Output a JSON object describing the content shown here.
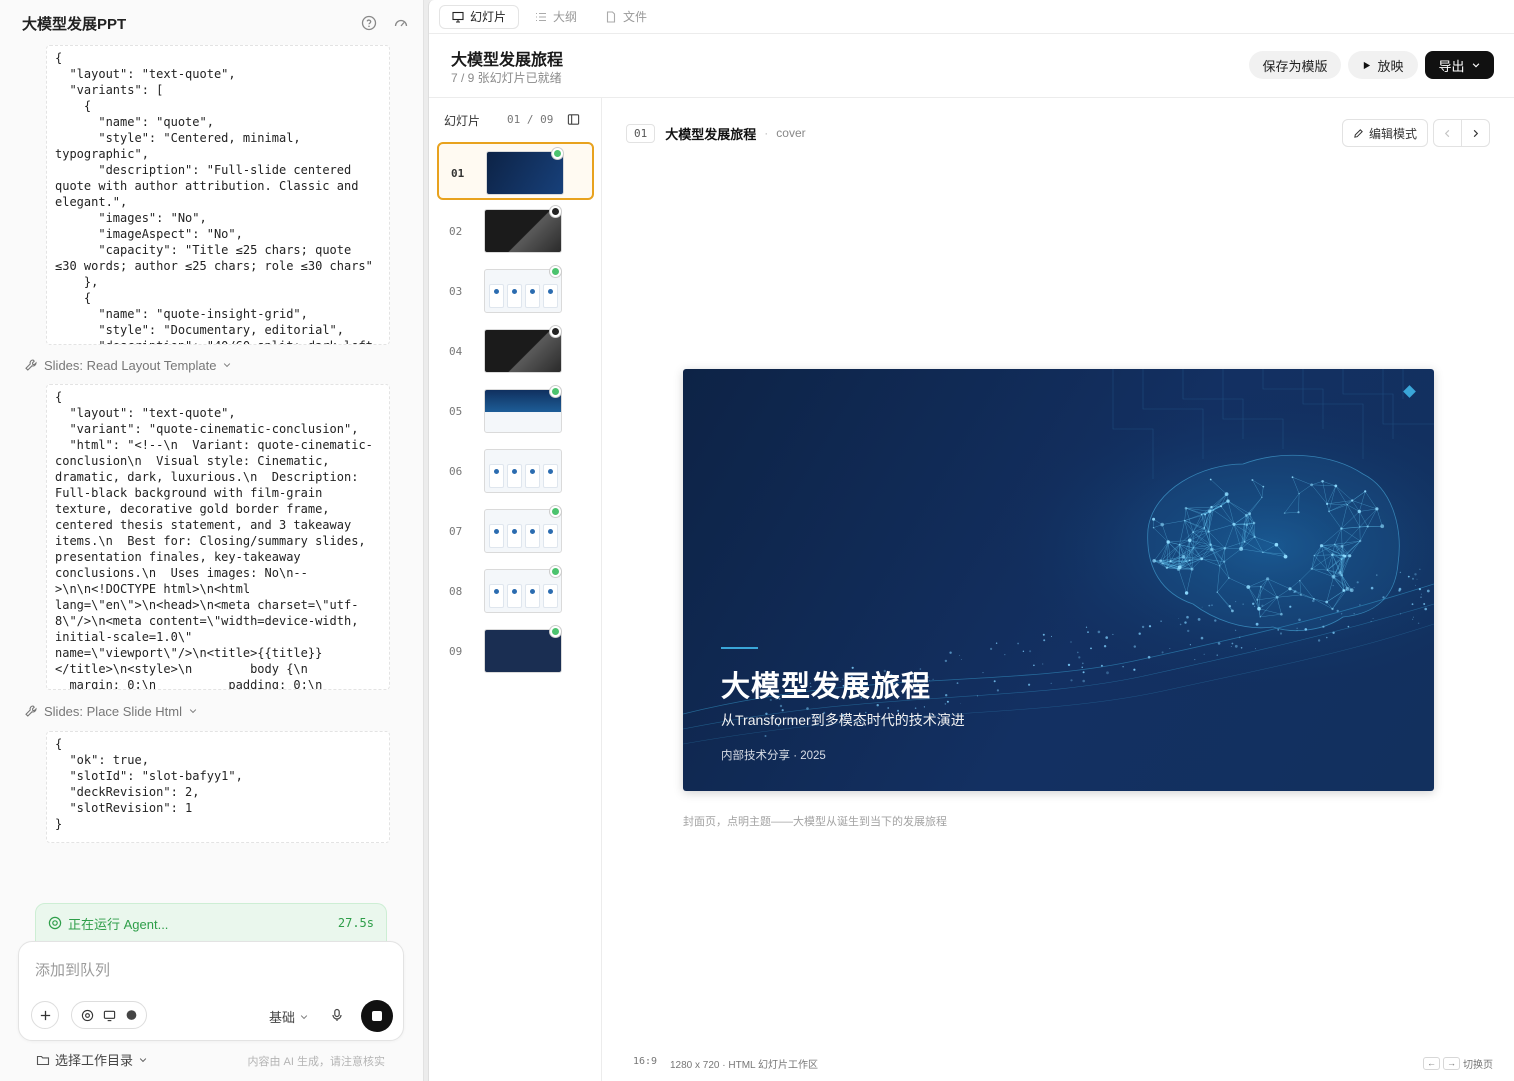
{
  "chat": {
    "title": "大模型发展PPT",
    "blocks": [
      "{\n  \"layout\": \"text-quote\",\n  \"variants\": [\n    {\n      \"name\": \"quote\",\n      \"style\": \"Centered, minimal,\ntypographic\",\n      \"description\": \"Full-slide centered\nquote with author attribution. Classic and\nelegant.\",\n      \"images\": \"No\",\n      \"imageAspect\": \"No\",\n      \"capacity\": \"Title ≤25 chars; quote\n≤30 words; author ≤25 chars; role ≤30 chars\"\n    },\n    {\n      \"name\": \"quote-insight-grid\",\n      \"style\": \"Documentary, editorial\",\n      \"description\": \"40/60 split: dark left",
      "{\n  \"layout\": \"text-quote\",\n  \"variant\": \"quote-cinematic-conclusion\",\n  \"html\": \"<!--\\n  Variant: quote-cinematic-\nconclusion\\n  Visual style: Cinematic,\ndramatic, dark, luxurious.\\n  Description:\nFull-black background with film-grain\ntexture, decorative gold border frame,\ncentered thesis statement, and 3 takeaway\nitems.\\n  Best for: Closing/summary slides,\npresentation finales, key-takeaway\nconclusions.\\n  Uses images: No\\n--\n>\\n\\n<!DOCTYPE html>\\n<html\nlang=\\\"en\\\">\\n<head>\\n<meta charset=\\\"utf-\n8\\\"/>\\n<meta content=\\\"width=device-width,\ninitial-scale=1.0\\\"\nname=\\\"viewport\\\"/>\\n<title>{{title}}\n</title>\\n<style>\\n        body {\\n\n  margin: 0;\\n          padding: 0;\\n",
      "{\n  \"ok\": true,\n  \"slotId\": \"slot-bafyy1\",\n  \"deckRevision\": 2,\n  \"slotRevision\": 1\n}"
    ],
    "tools": [
      "Slides: Read Layout Template",
      "Slides: Place Slide Html"
    ],
    "agent_status": "正在运行 Agent...",
    "agent_time": "27.5s",
    "composer_placeholder": "添加到队列",
    "mode": "基础",
    "workdir": "选择工作目录",
    "disclaimer": "内容由 AI 生成，请注意核实"
  },
  "tabs": [
    "幻灯片",
    "大纲",
    "文件"
  ],
  "deck": {
    "title": "大模型发展旅程",
    "subtitle": "7 / 9 张幻灯片已就绪",
    "save_template": "保存为模版",
    "play": "放映",
    "export": "导出"
  },
  "thumbs": {
    "label": "幻灯片",
    "count": "01 / 09",
    "items": [
      {
        "num": "01",
        "theme": "cover",
        "status": "ready"
      },
      {
        "num": "02",
        "theme": "dark",
        "status": "pending"
      },
      {
        "num": "03",
        "theme": "light",
        "status": "ready"
      },
      {
        "num": "04",
        "theme": "dark",
        "status": "pending"
      },
      {
        "num": "05",
        "theme": "cover-grid",
        "status": "ready"
      },
      {
        "num": "06",
        "theme": "light",
        "status": "none"
      },
      {
        "num": "07",
        "theme": "light",
        "status": "ready"
      },
      {
        "num": "08",
        "theme": "light",
        "status": "ready"
      },
      {
        "num": "09",
        "theme": "navy",
        "status": "ready"
      }
    ]
  },
  "stage": {
    "badge": "01",
    "title": "大模型发展旅程",
    "sep": "·",
    "type": "cover",
    "edit": "编辑模式",
    "note": "封面页，点明主题——大模型从诞生到当下的发展旅程"
  },
  "slide": {
    "title": "大模型发展旅程",
    "subtitle": "从Transformer到多模态时代的技术演进",
    "meta": "内部技术分享 · 2025"
  },
  "status": {
    "ratio": "16:9",
    "size": "1280 x 720 · HTML 幻灯片工作区",
    "kbd_left": "←",
    "kbd_right": "→",
    "hint": "切换页"
  },
  "colors": {
    "accent": "#e8a21e",
    "ready": "#4cc36e",
    "slide_bg": "#0f2750",
    "slide_accent": "#3aa6d8"
  }
}
